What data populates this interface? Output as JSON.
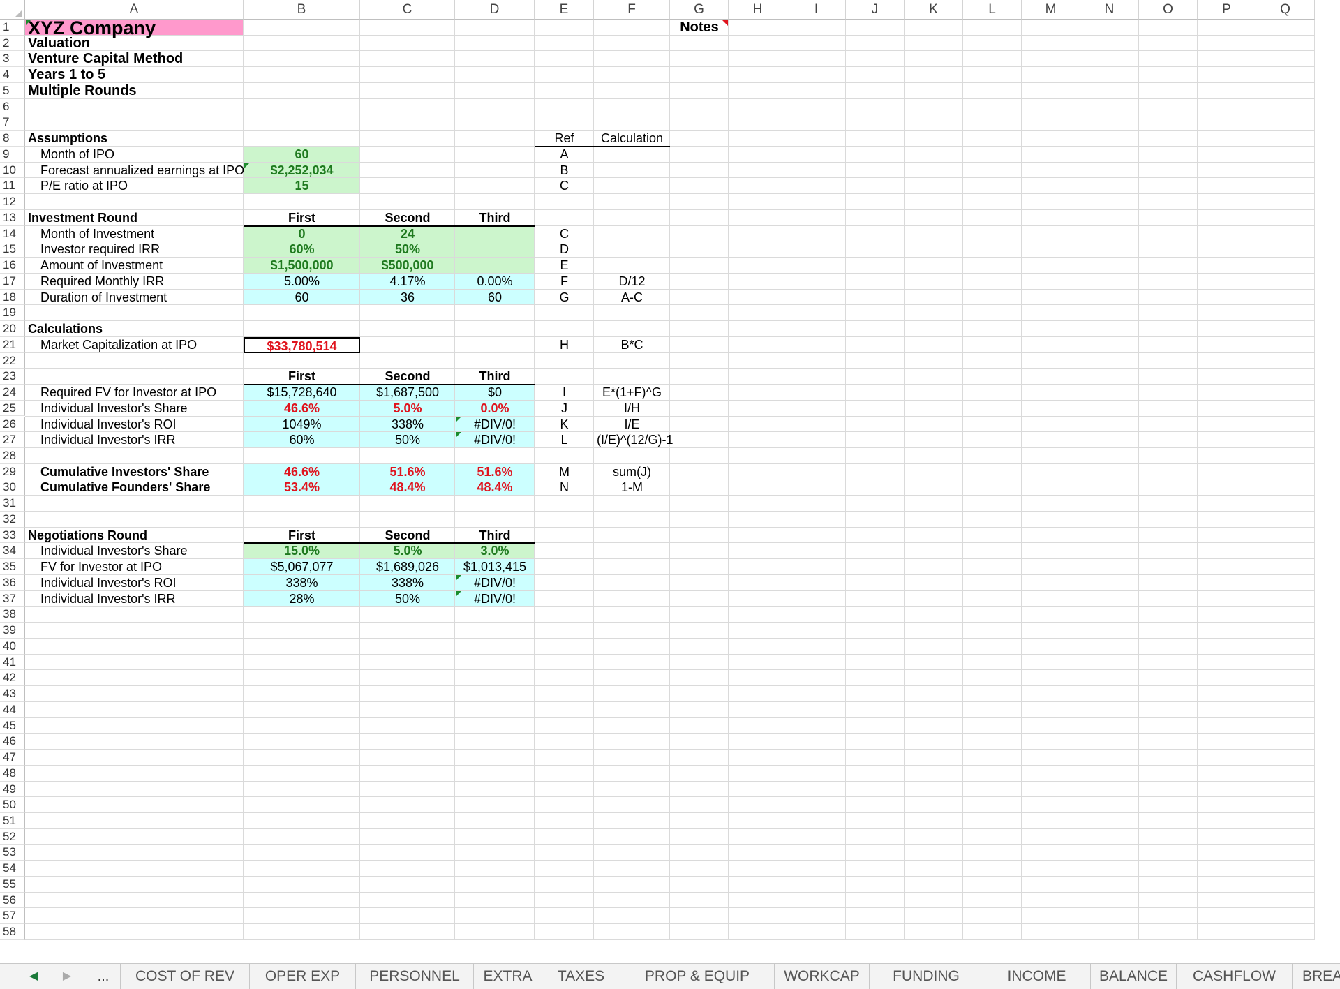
{
  "columns": [
    "A",
    "B",
    "C",
    "D",
    "E",
    "F",
    "G",
    "H",
    "I",
    "J",
    "K",
    "L",
    "M",
    "N",
    "O",
    "P",
    "Q"
  ],
  "rows": [
    "1",
    "2",
    "3",
    "4",
    "5",
    "6",
    "7",
    "8",
    "9",
    "10",
    "11",
    "12",
    "13",
    "14",
    "15",
    "16",
    "17",
    "18",
    "19",
    "20",
    "21",
    "22",
    "23",
    "24",
    "25",
    "26",
    "27",
    "28",
    "29",
    "30",
    "31",
    "32",
    "33",
    "34",
    "35",
    "36",
    "37",
    "38",
    "39",
    "40",
    "41",
    "42",
    "43",
    "44",
    "45",
    "46",
    "47",
    "48",
    "49",
    "50",
    "51",
    "52",
    "53",
    "54",
    "55",
    "56",
    "57",
    "58"
  ],
  "header": {
    "company": "XYZ Company",
    "valuation": "Valuation",
    "method": "Venture Capital Method",
    "years": "Years 1 to 5",
    "rounds": "Multiple Rounds",
    "notes": "Notes"
  },
  "assumptions": {
    "title": "Assumptions",
    "ref_header": "Ref",
    "calc_header": "Calculation",
    "rows": [
      {
        "label": "Month of IPO",
        "value": "60",
        "ref": "A"
      },
      {
        "label": "Forecast annualized earnings at IPO",
        "value": "$2,252,034",
        "ref": "B"
      },
      {
        "label": "P/E ratio at IPO",
        "value": "15",
        "ref": "C"
      }
    ]
  },
  "investment": {
    "title": "Investment Round",
    "cols": [
      "First",
      "Second",
      "Third"
    ],
    "rows": [
      {
        "label": "Month of Investment",
        "values": [
          "0",
          "24",
          ""
        ],
        "ref": "C",
        "calc": ""
      },
      {
        "label": "Investor required IRR",
        "values": [
          "60%",
          "50%",
          ""
        ],
        "ref": "D",
        "calc": ""
      },
      {
        "label": "Amount of Investment",
        "values": [
          "$1,500,000",
          "$500,000",
          ""
        ],
        "ref": "E",
        "calc": ""
      },
      {
        "label": "Required Monthly IRR",
        "values": [
          "5.00%",
          "4.17%",
          "0.00%"
        ],
        "ref": "F",
        "calc": "D/12"
      },
      {
        "label": "Duration of Investment",
        "values": [
          "60",
          "36",
          "60"
        ],
        "ref": "G",
        "calc": "A-C"
      }
    ]
  },
  "calculations": {
    "title": "Calculations",
    "market_cap_label": "Market Capitalization at IPO",
    "market_cap_value": "$33,780,514",
    "market_cap_ref": "H",
    "market_cap_calc": "B*C",
    "cols": [
      "First",
      "Second",
      "Third"
    ],
    "rows": [
      {
        "label": "Required FV for Investor at IPO",
        "values": [
          "$15,728,640",
          "$1,687,500",
          "$0"
        ],
        "ref": "I",
        "calc": "E*(1+F)^G"
      },
      {
        "label": "Individual Investor's Share",
        "values": [
          "46.6%",
          "5.0%",
          "0.0%"
        ],
        "ref": "J",
        "calc": "I/H"
      },
      {
        "label": "Individual Investor's ROI",
        "values": [
          "1049%",
          "338%",
          "#DIV/0!"
        ],
        "ref": "K",
        "calc": "I/E"
      },
      {
        "label": "Individual Investor's IRR",
        "values": [
          "60%",
          "50%",
          "#DIV/0!"
        ],
        "ref": "L",
        "calc": "(I/E)^(12/G)-1"
      }
    ],
    "cum_rows": [
      {
        "label": "Cumulative Investors' Share",
        "values": [
          "46.6%",
          "51.6%",
          "51.6%"
        ],
        "ref": "M",
        "calc": "sum(J)"
      },
      {
        "label": "Cumulative Founders' Share",
        "values": [
          "53.4%",
          "48.4%",
          "48.4%"
        ],
        "ref": "N",
        "calc": "1-M"
      }
    ]
  },
  "negotiations": {
    "title": "Negotiations Round",
    "cols": [
      "First",
      "Second",
      "Third"
    ],
    "rows": [
      {
        "label": "Individual Investor's Share",
        "values": [
          "15.0%",
          "5.0%",
          "3.0%"
        ]
      },
      {
        "label": "FV for Investor at IPO",
        "values": [
          "$5,067,077",
          "$1,689,026",
          "$1,013,415"
        ]
      },
      {
        "label": "Individual Investor's ROI",
        "values": [
          "338%",
          "338%",
          "#DIV/0!"
        ]
      },
      {
        "label": "Individual Investor's IRR",
        "values": [
          "28%",
          "50%",
          "#DIV/0!"
        ]
      }
    ]
  },
  "tabs": {
    "nav_prev": "◀",
    "nav_next": "▶",
    "more": "...",
    "items": [
      "COST OF REV",
      "OPER EXP",
      "PERSONNEL",
      "EXTRA",
      "TAXES",
      "PROP & EQUIP",
      "WORKCAP",
      "FUNDING",
      "INCOME",
      "BALANCE",
      "CASHFLOW",
      "BREA"
    ]
  },
  "colors": {
    "pink": "#ff99cc",
    "green_fill": "#ccf5cc",
    "cyan_fill": "#ccffff",
    "red_text": "#e0141e",
    "green_text": "#1f7a1f"
  }
}
